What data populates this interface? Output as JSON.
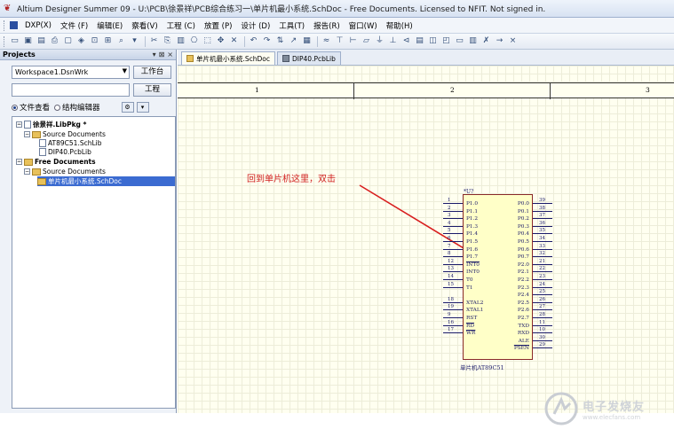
{
  "window": {
    "title": "Altium Designer Summer 09 - U:\\PCB\\徐景祥\\PCB综合练习一\\单片机最小系统.SchDoc - Free Documents. Licensed to NFIT. Not signed in."
  },
  "menu": [
    "DXP(X)",
    "文件 (F)",
    "编辑(E)",
    "察看(V)",
    "工程 (C)",
    "放置 (P)",
    "设计 (D)",
    "工具(T)",
    "报告(R)",
    "窗口(W)",
    "帮助(H)"
  ],
  "toolbar": {
    "icons": [
      "new-file-icon",
      "open-file-icon",
      "save-icon",
      "print-icon",
      "print-preview-icon",
      "component-icon",
      "zoom-fit-icon",
      "zoom-area-icon",
      "zoom-icon",
      "zoom-dropdown-icon",
      "cut-icon",
      "copy-icon",
      "paste-icon",
      "rubber-stamp-icon",
      "select-area-icon",
      "move-icon",
      "deselect-icon",
      "undo-icon",
      "redo-icon",
      "cross-probe-icon",
      "browse-icon",
      "compile-icon",
      "wire-icon",
      "bus-icon",
      "bus-entry-icon",
      "net-label-icon",
      "gnd-port-icon",
      "vcc-port-icon",
      "place-part-icon",
      "sheet-symbol-icon",
      "sheet-entry-icon",
      "device-sheet-icon",
      "port-icon",
      "harness-icon",
      "no-erc-icon",
      "directive-icon",
      "cross-icon"
    ]
  },
  "panel": {
    "title": "Projects",
    "controls": [
      "▾",
      "⊠",
      "×"
    ],
    "workspace": "Workspace1.DsnWrk",
    "workspace_btn": "工作台",
    "project_btn": "工程",
    "radio_files": "文件查看",
    "radio_structure": "结构编辑器",
    "tree": [
      {
        "label": "徐景祥.LibPkg *",
        "bold": true
      },
      {
        "label": "Source Documents"
      },
      {
        "label": "AT89C51.SchLib"
      },
      {
        "label": "DIP40.PcbLib"
      },
      {
        "label": "Free Documents",
        "bold": true
      },
      {
        "label": "Source Documents"
      },
      {
        "label": "单片机最小系统.SchDoc",
        "selected": true
      }
    ]
  },
  "tabs": [
    {
      "label": "单片机最小系统.SchDoc",
      "active": true
    },
    {
      "label": "DIP40.PcbLib",
      "active": false
    }
  ],
  "sheet": {
    "zones": [
      "1",
      "2",
      "3"
    ],
    "annotation": "回到单片机这里，双击",
    "designator": "*U?",
    "comment": "单片机AT89C51",
    "left_pins": [
      {
        "num": "1",
        "name": "P1.0"
      },
      {
        "num": "2",
        "name": "P1.1"
      },
      {
        "num": "3",
        "name": "P1.2"
      },
      {
        "num": "4",
        "name": "P1.3"
      },
      {
        "num": "5",
        "name": "P1.4"
      },
      {
        "num": "6",
        "name": "P1.5"
      },
      {
        "num": "7",
        "name": "P1.6"
      },
      {
        "num": "8",
        "name": "P1.7"
      },
      {
        "num": "12",
        "name": "INT0"
      },
      {
        "num": "13",
        "name": "INT0"
      },
      {
        "num": "14",
        "name": "T0"
      },
      {
        "num": "15",
        "name": "T1"
      },
      {
        "num": "",
        "name": ""
      },
      {
        "num": "18",
        "name": "XTAL2"
      },
      {
        "num": "19",
        "name": "XTAL1"
      },
      {
        "num": "9",
        "name": "RST"
      },
      {
        "num": "16",
        "name": "RD"
      },
      {
        "num": "17",
        "name": "WR"
      }
    ],
    "right_pins": [
      {
        "num": "39",
        "name": "P0.0"
      },
      {
        "num": "38",
        "name": "P0.1"
      },
      {
        "num": "37",
        "name": "P0.2"
      },
      {
        "num": "36",
        "name": "P0.3"
      },
      {
        "num": "35",
        "name": "P0.4"
      },
      {
        "num": "34",
        "name": "P0.5"
      },
      {
        "num": "33",
        "name": "P0.6"
      },
      {
        "num": "32",
        "name": "P0.7"
      },
      {
        "num": "21",
        "name": "P2.0"
      },
      {
        "num": "22",
        "name": "P2.1"
      },
      {
        "num": "23",
        "name": "P2.2"
      },
      {
        "num": "24",
        "name": "P2.3"
      },
      {
        "num": "25",
        "name": "P2.4"
      },
      {
        "num": "26",
        "name": "P2.5"
      },
      {
        "num": "27",
        "name": "P2.6"
      },
      {
        "num": "28",
        "name": "P2.7"
      },
      {
        "num": "11",
        "name": "TXD"
      },
      {
        "num": "10",
        "name": "RXD"
      },
      {
        "num": "30",
        "name": "ALE"
      },
      {
        "num": "29",
        "name": "PSEN"
      }
    ]
  },
  "watermark": {
    "brand": "电子发烧友",
    "url": "www.elecfans.com"
  }
}
